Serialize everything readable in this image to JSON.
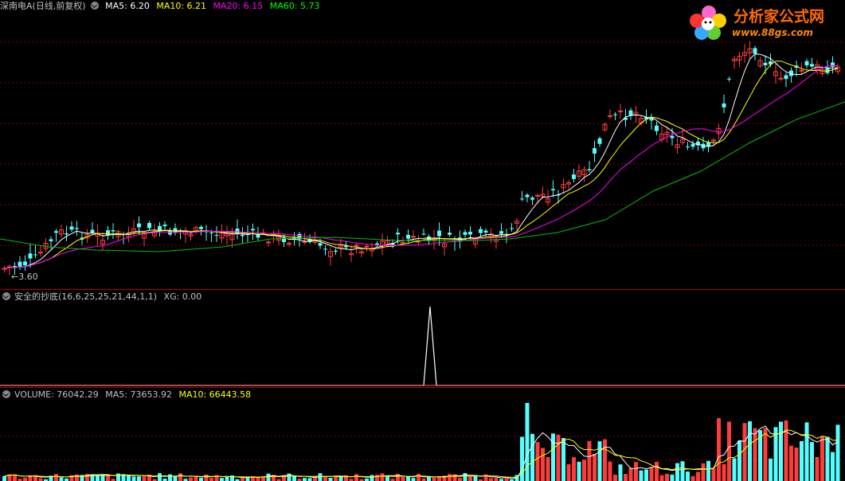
{
  "price": {
    "stock_title": "深南电A(日线,前复权)",
    "ma_labels": [
      "MA5: 6.20",
      "MA10: 6.21",
      "MA20: 6.15",
      "MA60: 5.73"
    ],
    "ma_colors": [
      "#ffffff",
      "#ffff00",
      "#ff00ff",
      "#00ff00"
    ],
    "low_label": "←3.60"
  },
  "indicator": {
    "title": "安全的抄底(16,6,25,25,21,44,1,1)",
    "xg_label": "XG: 0.00"
  },
  "volume": {
    "labels": [
      "VOLUME: 76042.29",
      "MA5: 73653.92",
      "MA10: 66443.58"
    ],
    "colors": [
      "#c0c0c0",
      "#c0c0c0",
      "#ffff00"
    ]
  },
  "logo": {
    "title": "分析家公式网",
    "url": "www.88gs.com"
  },
  "colors": {
    "up": "#ff3c3c",
    "down": "#54ffff",
    "separator": "#b00000",
    "grid": "#8b0000"
  }
}
